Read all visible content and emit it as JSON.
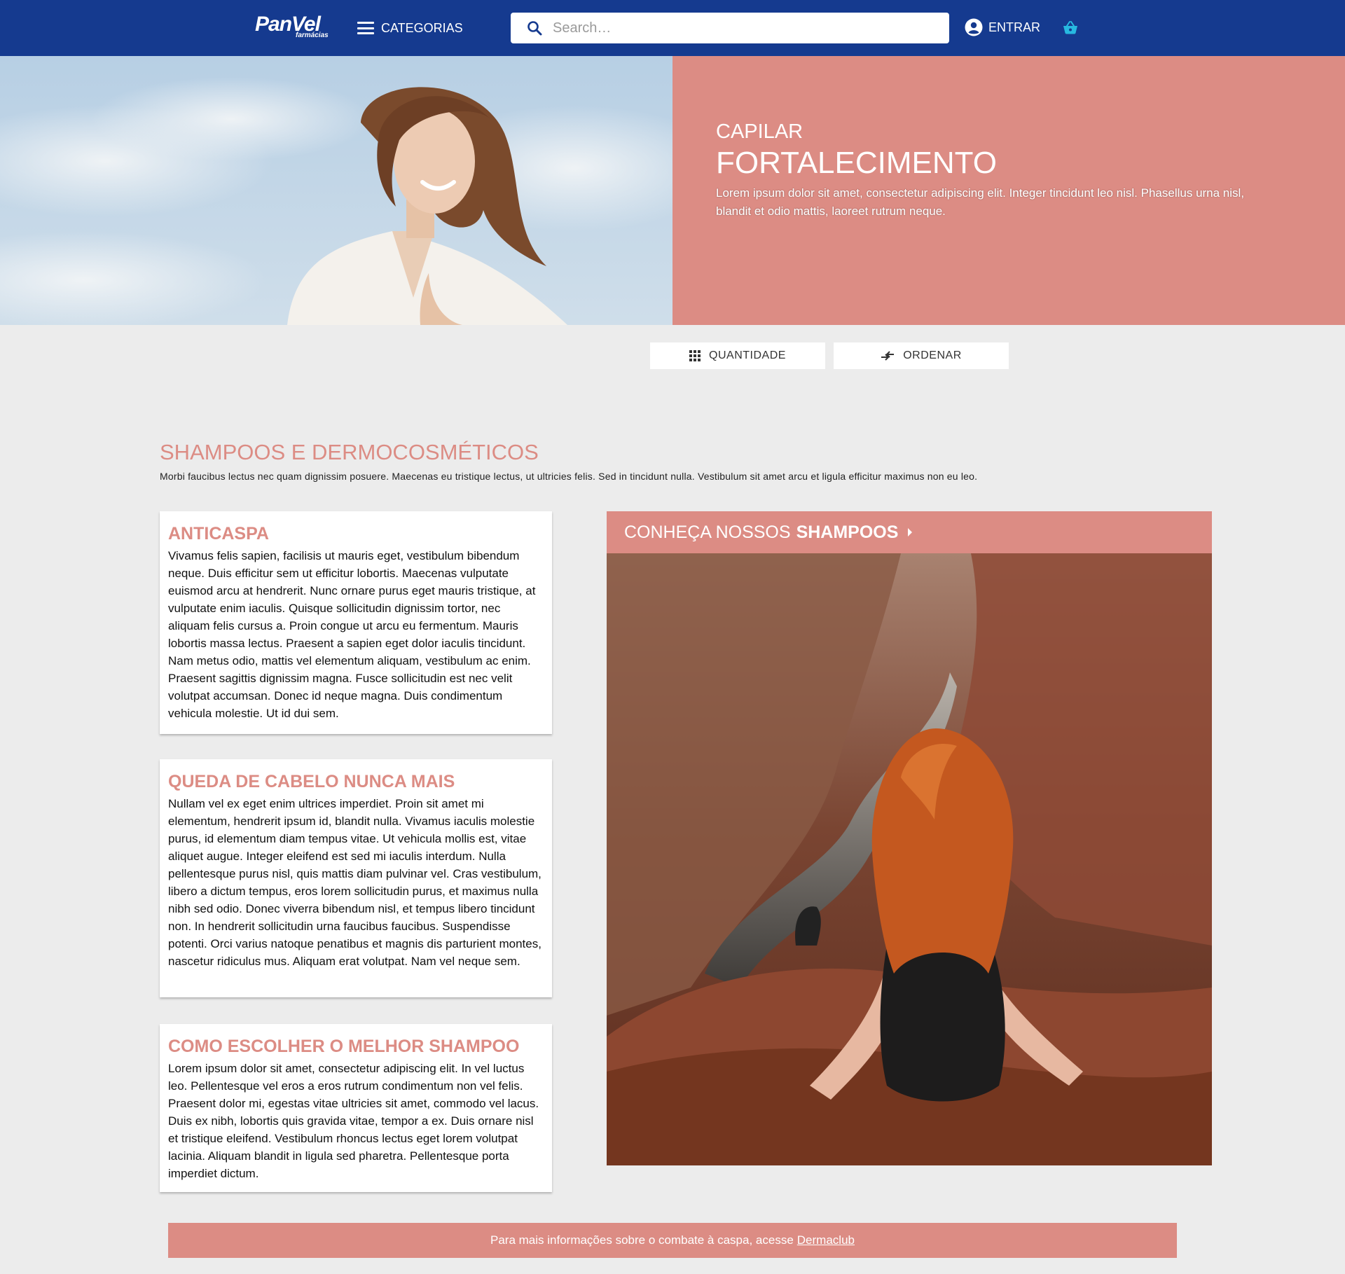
{
  "header": {
    "logo_main": "PanVel",
    "logo_sub": "farmácias",
    "categories_label": "CATEGORIAS",
    "search_placeholder": "Search…",
    "login_label": "ENTRAR",
    "colors": {
      "background": "#153a8f",
      "cart_icon": "#27b9e0"
    }
  },
  "hero": {
    "kicker": "CAPILAR",
    "title": "FORTALECIMENTO",
    "text": "Lorem ipsum dolor sit amet, consectetur adipiscing elit. Integer tincidunt leo nisl. Phasellus urna nisl, blandit et odio mattis, laoreet rutrum neque.",
    "panel_color": "#dc8c84"
  },
  "filters": {
    "quantity_label": "QUANTIDADE",
    "order_label": "ORDENAR"
  },
  "section": {
    "title": "SHAMPOOS E DERMOCOSMÉTICOS",
    "description": "Morbi faucibus lectus nec quam dignissim posuere. Maecenas eu tristique lectus, ut ultricies felis. Sed in tincidunt nulla. Vestibulum sit amet arcu et ligula efficitur maximus non eu leo."
  },
  "cards": [
    {
      "title": "ANTICASPA",
      "text": "Vivamus felis sapien, facilisis ut mauris eget, vestibulum bibendum neque. Duis efficitur sem ut efficitur lobortis. Maecenas vulputate euismod arcu at hendrerit. Nunc ornare purus eget mauris tristique, at vulputate enim iaculis. Quisque sollicitudin dignissim tortor, nec aliquam felis cursus a. Proin congue ut arcu eu fermentum. Mauris lobortis massa lectus. Praesent a sapien eget dolor iaculis tincidunt. Nam metus odio, mattis vel elementum aliquam, vestibulum ac enim. Praesent sagittis dignissim magna. Fusce sollicitudin est nec velit volutpat accumsan. Donec id neque magna. Duis condimentum vehicula molestie. Ut id dui sem."
    },
    {
      "title": "QUEDA DE CABELO NUNCA MAIS",
      "text": "Nullam vel ex eget enim ultrices imperdiet. Proin sit amet mi elementum, hendrerit ipsum id, blandit nulla. Vivamus iaculis molestie purus, id elementum diam tempus vitae. Ut vehicula mollis est, vitae aliquet augue. Integer eleifend est sed mi iaculis interdum. Nulla pellentesque purus nisl, quis mattis diam pulvinar vel. Cras vestibulum, libero a dictum tempus, eros lorem sollicitudin purus, et maximus nulla nibh sed odio. Donec viverra bibendum nisl, et tempus libero tincidunt non. In hendrerit sollicitudin urna faucibus faucibus. Suspendisse potenti. Orci varius natoque penatibus et magnis dis parturient montes, nascetur ridiculus mus. Aliquam erat volutpat. Nam vel neque sem."
    },
    {
      "title": "COMO ESCOLHER O MELHOR SHAMPOO",
      "text": "Lorem ipsum dolor sit amet, consectetur adipiscing elit. In vel luctus leo. Pellentesque vel eros a eros rutrum condimentum non vel felis. Praesent dolor mi, egestas vitae ultricies sit amet, commodo vel lacus. Duis ex nibh, lobortis quis gravida vitae, tempor a ex. Duis ornare nisl et tristique eleifend. Vestibulum rhoncus lectus eget lorem volutpat lacinia. Aliquam blandit in ligula sed pharetra. Pellentesque porta imperdiet dictum."
    }
  ],
  "promo": {
    "prefix": "CONHEÇA NOSSOS",
    "highlight": "SHAMPOOS"
  },
  "footer": {
    "text": "Para mais informações sobre o combate à caspa, acesse",
    "link_label": "Dermaclub"
  }
}
